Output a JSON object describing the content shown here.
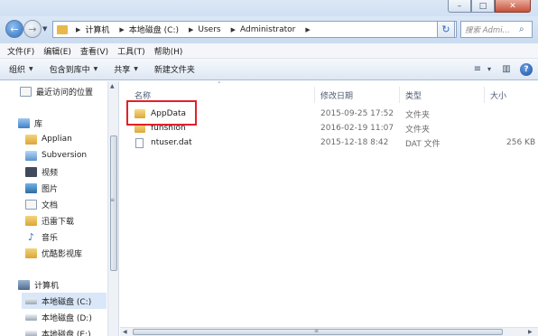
{
  "window": {
    "caption_minimize": "–",
    "caption_maximize": "□",
    "caption_close": "✕"
  },
  "nav": {
    "back_icon": "back-arrow-icon",
    "forward_icon": "forward-arrow-icon",
    "back_glyph": "←",
    "forward_glyph": "→",
    "recent_glyph": "▼",
    "refresh_glyph": "↻",
    "breadcrumb": [
      "计算机",
      "本地磁盘 (C:)",
      "Users",
      "Administrator"
    ],
    "sep_glyph": "▶",
    "dropdown_glyph": "▼",
    "search_placeholder": "搜索 Admi...",
    "search_glyph": "⌕"
  },
  "menubar": [
    "文件(F)",
    "编辑(E)",
    "查看(V)",
    "工具(T)",
    "帮助(H)"
  ],
  "commandbar": {
    "items": [
      {
        "label": "组织",
        "has_dropdown": true
      },
      {
        "label": "包含到库中",
        "has_dropdown": true
      },
      {
        "label": "共享",
        "has_dropdown": true
      },
      {
        "label": "新建文件夹",
        "has_dropdown": false
      }
    ],
    "dropdown_glyph": "▼",
    "view_glyph": "≡",
    "view_more_glyph": "▾",
    "preview_glyph": "▥",
    "help_glyph": "?"
  },
  "sidebar": {
    "items": [
      {
        "label": "最近访问的位置",
        "icon": "recent-places-icon",
        "indent": 1
      },
      {
        "label": "库",
        "icon": "libraries-icon",
        "indent": 0
      },
      {
        "label": "Applian",
        "icon": "folder-icon",
        "indent": 1
      },
      {
        "label": "Subversion",
        "icon": "subversion-icon",
        "indent": 1
      },
      {
        "label": "视频",
        "icon": "videos-icon",
        "indent": 1
      },
      {
        "label": "图片",
        "icon": "pictures-icon",
        "indent": 1
      },
      {
        "label": "文档",
        "icon": "documents-icon",
        "indent": 1
      },
      {
        "label": "迅雷下载",
        "icon": "folder-icon",
        "indent": 1
      },
      {
        "label": "音乐",
        "icon": "music-icon",
        "indent": 1
      },
      {
        "label": "优酷影视库",
        "icon": "folder-icon",
        "indent": 1
      },
      {
        "label": "计算机",
        "icon": "computer-icon",
        "indent": 0
      },
      {
        "label": "本地磁盘 (C:)",
        "icon": "drive-icon",
        "indent": 1,
        "selected": true
      },
      {
        "label": "本地磁盘 (D:)",
        "icon": "drive-icon",
        "indent": 1
      },
      {
        "label": "本地磁盘 (E:)",
        "icon": "drive-icon",
        "indent": 1
      }
    ],
    "music_glyph": "♪"
  },
  "filelist": {
    "sort_glyph": "˄",
    "columns": [
      "名称",
      "修改日期",
      "类型",
      "大小"
    ],
    "rows": [
      {
        "name": "AppData",
        "modified": "2015-09-25 17:52",
        "type": "文件夹",
        "size": "",
        "kind": "folder"
      },
      {
        "name": "funshion",
        "modified": "2016-02-19 11:07",
        "type": "文件夹",
        "size": "",
        "kind": "folder"
      },
      {
        "name": "ntuser.dat",
        "modified": "2015-12-18 8:42",
        "type": "DAT 文件",
        "size": "256 KB",
        "kind": "file"
      }
    ]
  },
  "scrollbars": {
    "up_glyph": "▲",
    "down_glyph": "▼",
    "left_glyph": "◀",
    "right_glyph": "▶",
    "grip_glyph": "≡"
  },
  "colors": {
    "highlight_border": "#e2202a",
    "selected_bg": "#d9e7f8"
  }
}
